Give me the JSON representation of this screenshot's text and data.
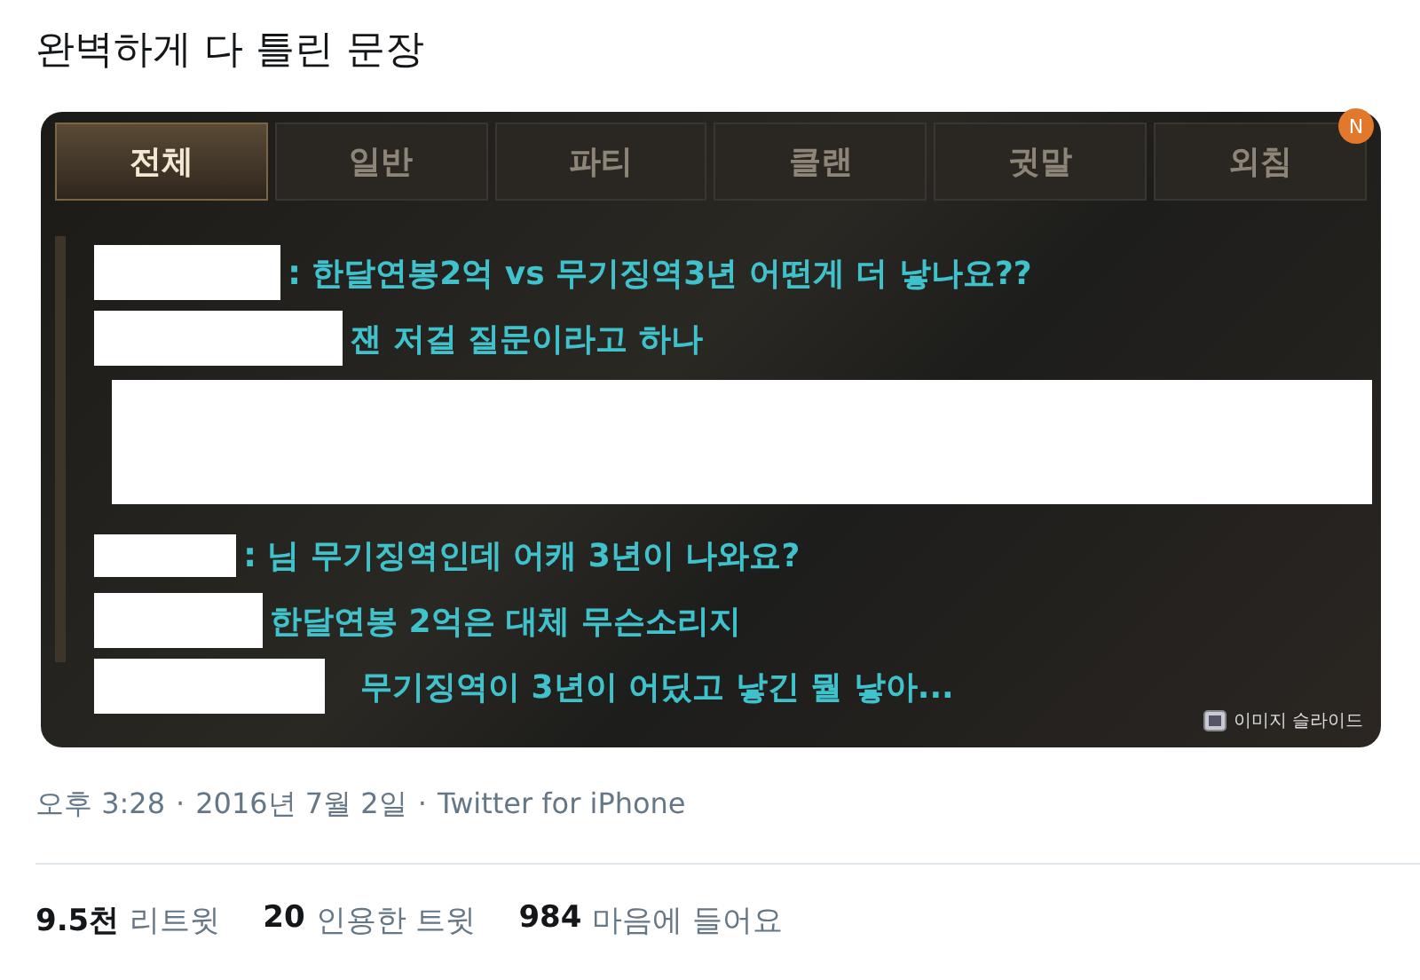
{
  "tweet": {
    "text": "완벽하게 다 틀린 문장"
  },
  "image": {
    "tabs": [
      {
        "label": "전체",
        "selected": true
      },
      {
        "label": "일반",
        "selected": false
      },
      {
        "label": "파티",
        "selected": false
      },
      {
        "label": "클랜",
        "selected": false
      },
      {
        "label": "귓말",
        "selected": false
      },
      {
        "label": "외침",
        "selected": false,
        "badge": "N"
      }
    ],
    "chat": [
      {
        "kind": "message",
        "separator": ":",
        "text": "한달연봉2억 vs 무기징역3년 어떤게 더 낳나요??"
      },
      {
        "kind": "message",
        "text": "잰 저걸 질문이라고 하나"
      },
      {
        "kind": "redacted"
      },
      {
        "kind": "message",
        "separator": ":",
        "text": "님 무기징역인데 어캐 3년이 나와요?"
      },
      {
        "kind": "message",
        "text": "한달연봉 2억은 대체 무슨소리지"
      },
      {
        "kind": "message",
        "text": "무기징역이 3년이 어딨고 낳긴 뭘 낳아..."
      }
    ],
    "slide_label": "이미지 슬라이드"
  },
  "meta": {
    "time": "오후 3:28",
    "separator": "·",
    "date": "2016년 7월 2일",
    "separator_2": "·",
    "source": "Twitter for iPhone"
  },
  "stats": [
    {
      "count": "9.5천",
      "label": "리트윗"
    },
    {
      "count": "20",
      "label": "인용한 트윗"
    },
    {
      "count": "984",
      "label": "마음에 들어요"
    }
  ]
}
